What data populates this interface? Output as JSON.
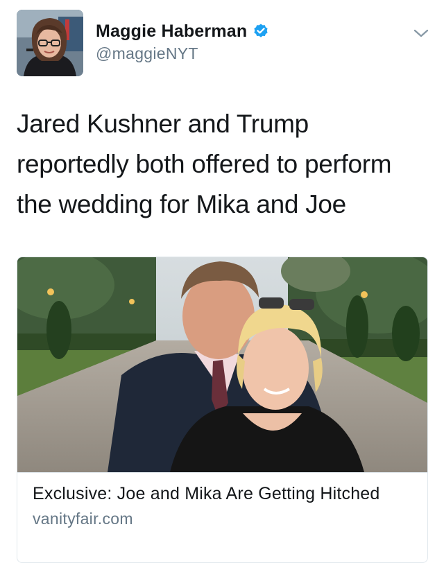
{
  "author": {
    "display_name": "Maggie Haberman",
    "handle": "@maggieNYT",
    "verified": true,
    "avatar_icon": "profile-photo"
  },
  "tweet": {
    "text_lines": [
      "Jared Kushner and Trump",
      "reportedly both offered to perform",
      "the wedding for Mika and Joe"
    ]
  },
  "card": {
    "title": "Exclusive: Joe and Mika Are Getting Hitched",
    "domain": "vanityfair.com"
  },
  "colors": {
    "verified_blue": "#1da1f2",
    "text": "#14171a",
    "secondary": "#657786",
    "border": "#e1e8ed"
  }
}
